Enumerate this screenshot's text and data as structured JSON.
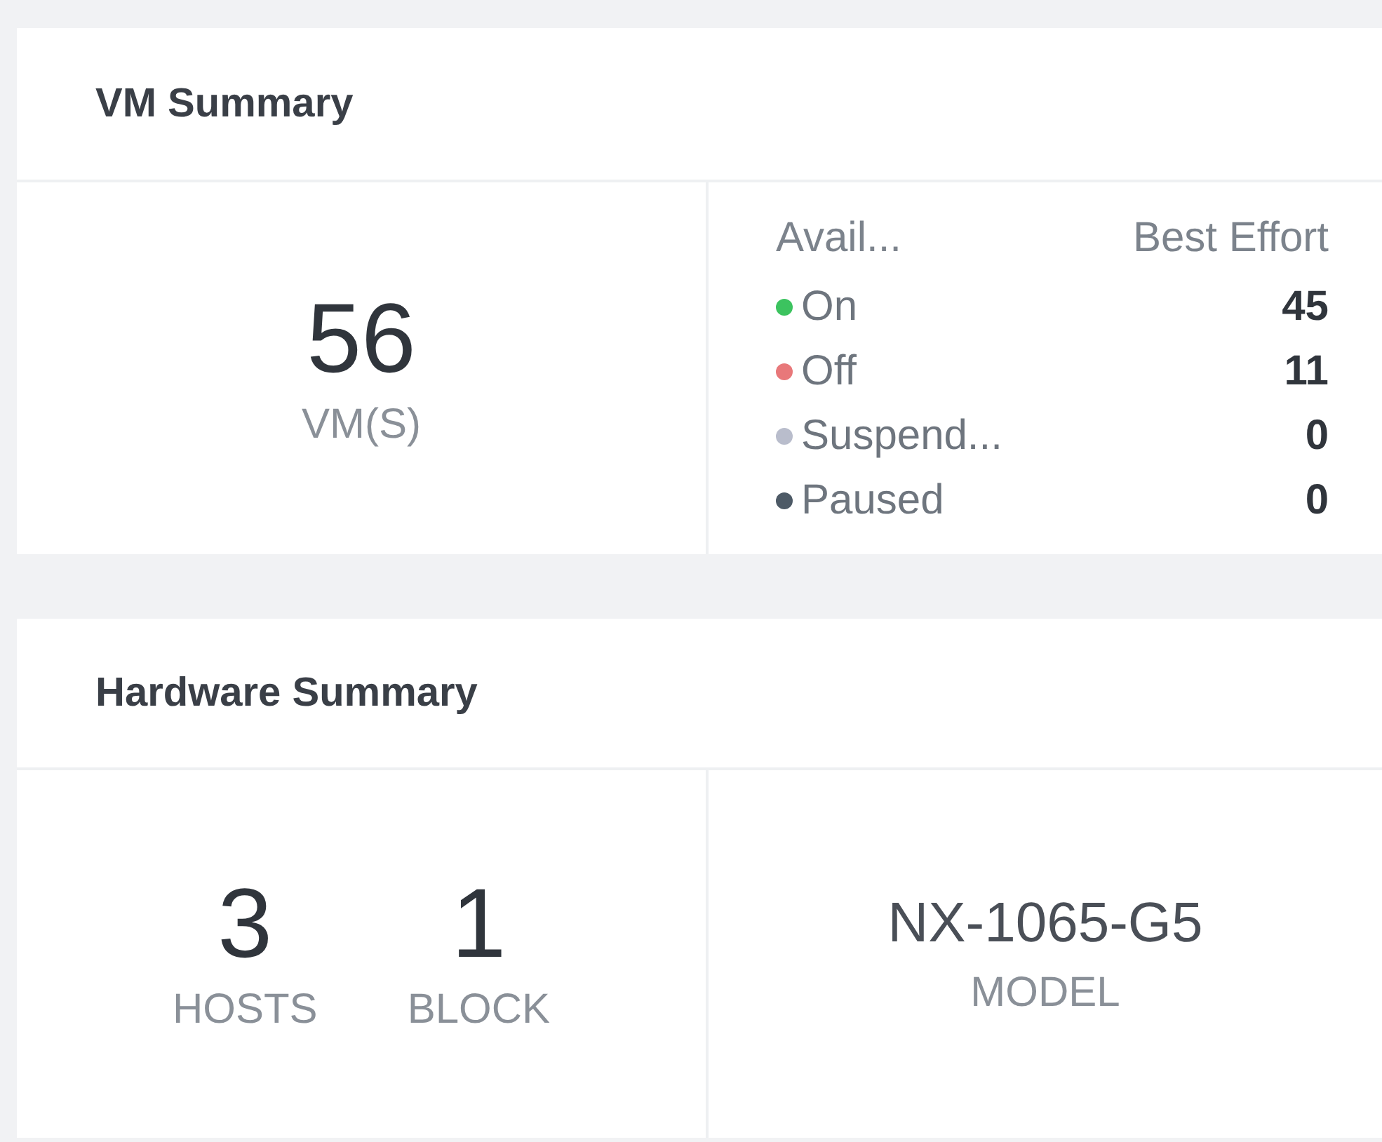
{
  "vm_summary": {
    "title": "VM Summary",
    "total": {
      "value": "56",
      "label": "VM(S)"
    },
    "list": {
      "column_1": "Avail...",
      "column_2": "Best Effort",
      "rows": [
        {
          "label": "On",
          "count": "45",
          "color": "#3cc35f"
        },
        {
          "label": "Off",
          "count": "11",
          "color": "#e8787a"
        },
        {
          "label": "Suspend...",
          "count": "0",
          "color": "#b9bdcc"
        },
        {
          "label": "Paused",
          "count": "0",
          "color": "#4d5a66"
        }
      ]
    }
  },
  "hardware_summary": {
    "title": "Hardware Summary",
    "stats": [
      {
        "value": "3",
        "label": "HOSTS"
      },
      {
        "value": "1",
        "label": "BLOCK"
      }
    ],
    "model": {
      "value": "NX-1065-G5",
      "label": "MODEL"
    }
  }
}
